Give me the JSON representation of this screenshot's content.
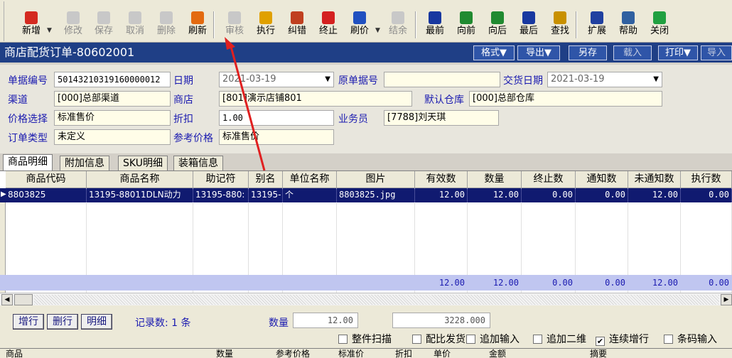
{
  "toolbar": {
    "buttons": [
      {
        "label": "新增",
        "icon": "add-icon",
        "color": "#d42a20",
        "disabled": false
      },
      {
        "label": "修改",
        "icon": "edit-icon",
        "color": "#8a8a8a",
        "disabled": true
      },
      {
        "label": "保存",
        "icon": "save-icon",
        "color": "#8a8a8a",
        "disabled": true
      },
      {
        "label": "取消",
        "icon": "cancel-icon",
        "color": "#8a8a8a",
        "disabled": true
      },
      {
        "label": "删除",
        "icon": "delete-icon",
        "color": "#8a8a8a",
        "disabled": true
      },
      {
        "label": "刷新",
        "icon": "refresh-icon",
        "color": "#e36a10",
        "disabled": false
      },
      {
        "label": "审核",
        "icon": "audit-icon",
        "color": "#8a8a8a",
        "disabled": true
      },
      {
        "label": "执行",
        "icon": "execute-icon",
        "color": "#e0a000",
        "disabled": false
      },
      {
        "label": "纠错",
        "icon": "correct-icon",
        "color": "#c04020",
        "disabled": false
      },
      {
        "label": "终止",
        "icon": "stop-icon",
        "color": "#d42020",
        "disabled": false
      },
      {
        "label": "刷价",
        "icon": "price-icon",
        "color": "#2050c0",
        "disabled": false
      },
      {
        "label": "结余",
        "icon": "balance-icon",
        "color": "#8a8a8a",
        "disabled": true
      },
      {
        "label": "最前",
        "icon": "first-icon",
        "color": "#1838a0",
        "disabled": false
      },
      {
        "label": "向前",
        "icon": "prev-icon",
        "color": "#208a30",
        "disabled": false
      },
      {
        "label": "向后",
        "icon": "next-icon",
        "color": "#208a30",
        "disabled": false
      },
      {
        "label": "最后",
        "icon": "last-icon",
        "color": "#1838a0",
        "disabled": false
      },
      {
        "label": "查找",
        "icon": "find-icon",
        "color": "#c89000",
        "disabled": false
      },
      {
        "label": "扩展",
        "icon": "grid-icon",
        "color": "#2040a0",
        "disabled": false
      },
      {
        "label": "帮助",
        "icon": "help-icon",
        "color": "#3060a0",
        "disabled": false
      },
      {
        "label": "关闭",
        "icon": "close-icon",
        "color": "#20a040",
        "disabled": false
      }
    ]
  },
  "title": "商店配货订单-80602001",
  "title_buttons": [
    "格式▼",
    "导出▼",
    "另存",
    "载入",
    "打印▼",
    "导入"
  ],
  "form": {
    "doc_no_label": "单据编号",
    "doc_no": "50143210319160000012",
    "date_label": "日期",
    "date": "2021-03-19",
    "orig_label": "原单据号",
    "orig": "",
    "delivery_label": "交货日期",
    "delivery": "2021-03-19",
    "channel_label": "渠道",
    "channel": "[000]总部渠道",
    "store_label": "商店",
    "store": "[801]演示店铺801",
    "warehouse_label": "默认仓库",
    "warehouse": "[000]总部仓库",
    "price_label": "价格选择",
    "price": "标准售价",
    "discount_label": "折扣",
    "discount": "1.00",
    "clerk_label": "业务员",
    "clerk": "[7788]刘天琪",
    "order_type_label": "订单类型",
    "order_type": "未定义",
    "ref_price_label": "参考价格",
    "ref_price": "标准售价"
  },
  "tabs": [
    "商品明细",
    "附加信息",
    "SKU明细",
    "装箱信息"
  ],
  "grid": {
    "headers": [
      "商品代码",
      "商品名称",
      "助记符",
      "别名",
      "单位名称",
      "图片",
      "有效数",
      "数量",
      "终止数",
      "通知数",
      "未通知数",
      "执行数"
    ],
    "row": [
      "8803825",
      "13195-88011DLN动力",
      "13195-880:",
      "13195-",
      "个",
      "8803825.jpg",
      "12.00",
      "12.00",
      "0.00",
      "0.00",
      "12.00",
      "0.00"
    ],
    "totals": [
      "12.00",
      "12.00",
      "0.00",
      "0.00",
      "12.00",
      "0.00"
    ]
  },
  "bottom": {
    "btn_add_row": "增行",
    "btn_del_row": "删行",
    "btn_detail": "明细",
    "record_count": "记录数: 1 条",
    "qty_label": "数量",
    "qty": "12.00",
    "amount": "3228.000",
    "checks": [
      {
        "label": "整件扫描",
        "checked": false
      },
      {
        "label": "配比发货",
        "checked": false
      },
      {
        "label": "追加输入",
        "checked": false
      },
      {
        "label": "追加二维",
        "checked": false
      },
      {
        "label": "连续增行",
        "checked": true
      },
      {
        "label": "条码输入",
        "checked": false
      }
    ]
  },
  "footer_headers": [
    "商品",
    "数量",
    "参考价格",
    "标准价",
    "折扣",
    "单价",
    "金额",
    "摘要"
  ]
}
